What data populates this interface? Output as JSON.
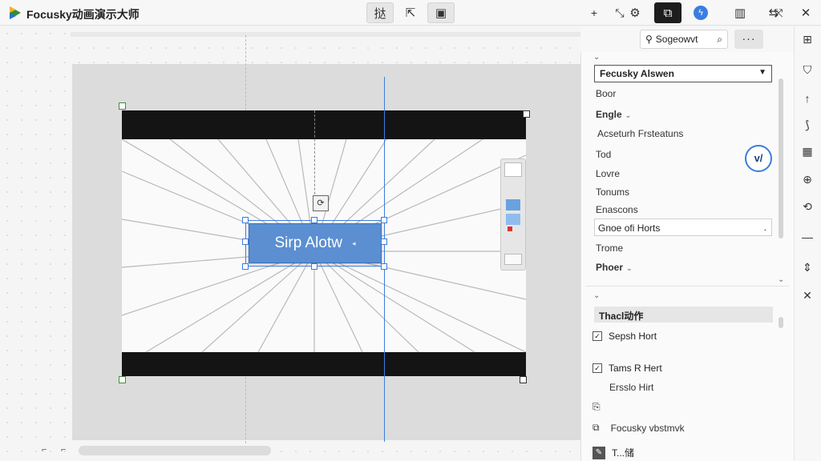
{
  "titlebar": {
    "app_title": "Focusky动画演示大师",
    "center_buttons": [
      "挞",
      "⇱",
      "▣"
    ],
    "right_buttons": [
      "⚙",
      "⧉",
      "ϟ",
      "▥",
      "⇆",
      "✕"
    ]
  },
  "slide": {
    "cta_label": "Sirp Alotw",
    "cta_mini": "◂"
  },
  "panel_toolbar": {
    "add": "+",
    "collapse": "⤡",
    "search_label": "Sogeowvt",
    "more": "···",
    "expand": "⤧"
  },
  "panel": {
    "dropdown_value": "Fecusky Alswen",
    "rows": [
      {
        "label": "Boor",
        "bold": false
      },
      {
        "label": "Engle",
        "bold": true,
        "caret": "⌄"
      },
      {
        "label": "Acseturh Frsteatuns",
        "bold": false
      },
      {
        "label": "Tod",
        "bold": false
      },
      {
        "label": "Lovre",
        "bold": false
      },
      {
        "label": "Tonums",
        "bold": false
      },
      {
        "label": "Enascons",
        "bold": false
      },
      {
        "label": "Trome",
        "bold": false
      },
      {
        "label": "Phoer",
        "bold": true,
        "caret": "⌄"
      }
    ],
    "field_value": "Gnoe ofi Horts",
    "field_dot": ".",
    "chat_label": "v/",
    "section_caret_top": "⌄",
    "section_caret_mid": "⌄",
    "section_caret_mid2": "⌄",
    "section_head": "Thacl动作",
    "checks": [
      {
        "label": "Sepsh Hort",
        "checked": true
      },
      {
        "label": "Tams R Hert",
        "checked": true
      }
    ],
    "plain_row": "Ersslo Hirt",
    "icon_rows": [
      {
        "icon": "⎘",
        "label": ""
      },
      {
        "icon": "⧉",
        "label": "Focusky vbstmvk"
      }
    ],
    "bottom_icon": "✎",
    "bottom_label": "T...储"
  },
  "vtoolbar": [
    "⊞",
    "⛉",
    "↑",
    "⟆",
    "▦",
    "⊕",
    "⟲",
    "—",
    "⇕",
    "✕"
  ],
  "canvas": {
    "scroll_left": "⌐",
    "scroll_right": "⌐"
  }
}
